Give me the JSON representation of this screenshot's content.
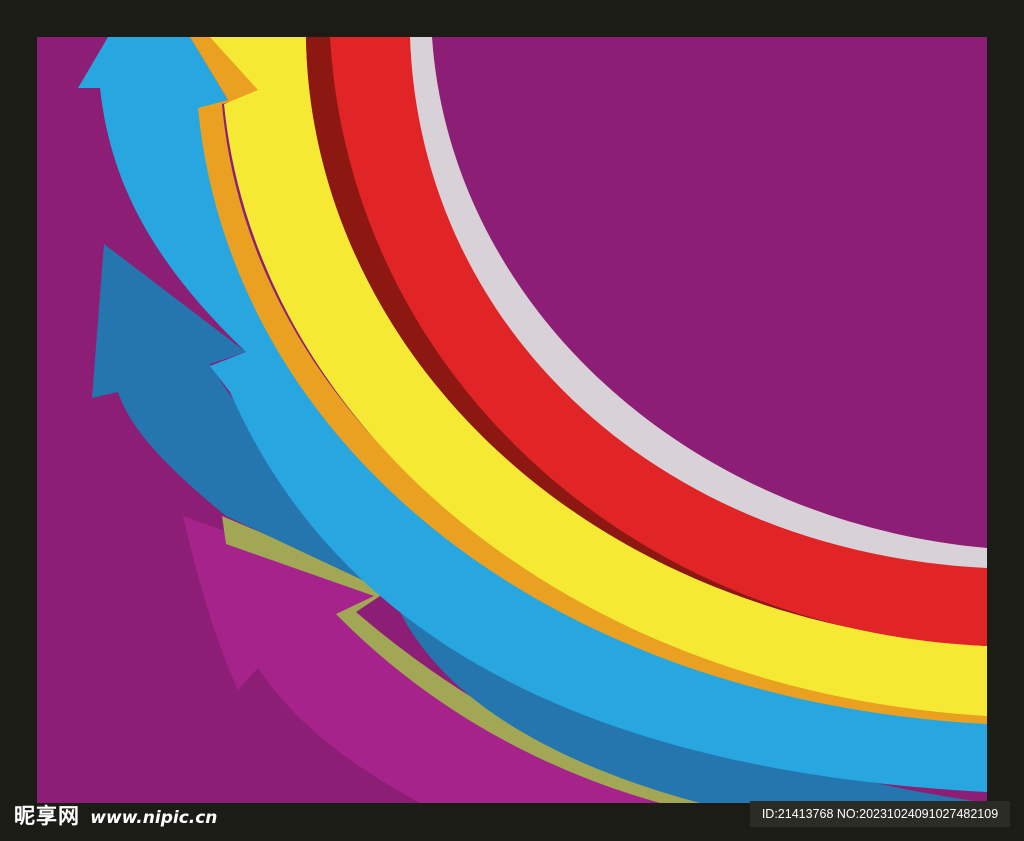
{
  "image": {
    "description_colors": {
      "frame": "#1b1c16",
      "background": "#8d1e76",
      "magenta_arrow": "#a5238a",
      "olive_outline": "#a2a756",
      "dark_blue": "#2575ae",
      "light_blue": "#27a6e0",
      "orange_edge": "#eaa020",
      "yellow": "#f6e934",
      "dark_red": "#8d1812",
      "red": "#e12426",
      "light_gray": "#d8d2d8"
    }
  },
  "watermark": {
    "brand": "昵享网",
    "site": "www.nipic.cn"
  },
  "id_label": {
    "text": "ID:21413768 NO:20231024091027482109"
  }
}
